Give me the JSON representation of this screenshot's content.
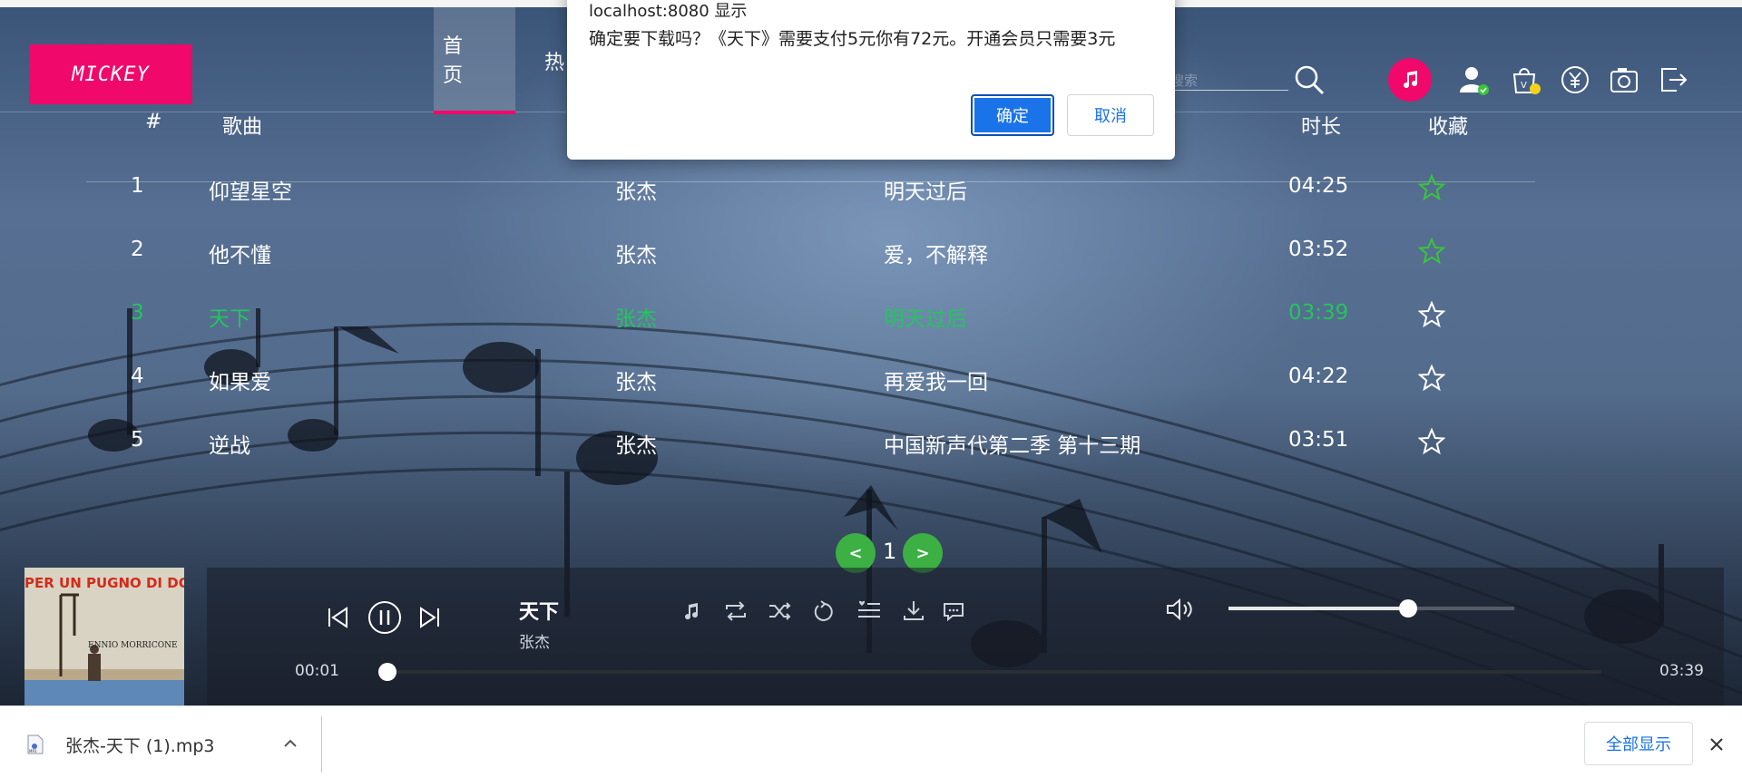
{
  "header": {
    "logo": "MICKEY",
    "nav": {
      "home": "首 页",
      "hot": "热"
    },
    "search_placeholder": "搜索"
  },
  "table": {
    "columns": {
      "index": "#",
      "song": "歌曲",
      "duration": "时长",
      "favorite": "收藏"
    },
    "rows": [
      {
        "index": "1",
        "song": "仰望星空",
        "singer": "张杰",
        "album": "明天过后",
        "duration": "04:25",
        "favorited": true,
        "playing": false
      },
      {
        "index": "2",
        "song": "他不懂",
        "singer": "张杰",
        "album": "爱，不解释",
        "duration": "03:52",
        "favorited": true,
        "playing": false
      },
      {
        "index": "3",
        "song": "天下",
        "singer": "张杰",
        "album": "明天过后",
        "duration": "03:39",
        "favorited": false,
        "playing": true
      },
      {
        "index": "4",
        "song": "如果爱",
        "singer": "张杰",
        "album": "再爱我一回",
        "duration": "04:22",
        "favorited": false,
        "playing": false
      },
      {
        "index": "5",
        "song": "逆战",
        "singer": "张杰",
        "album": "中国新声代第二季 第十三期",
        "duration": "03:51",
        "favorited": false,
        "playing": false
      }
    ]
  },
  "pagination": {
    "prev": "<",
    "page": "1",
    "next": ">"
  },
  "player": {
    "cover_text_top": "PER UN PUGNO DI DOLLA",
    "cover_text_composer": "ENNIO MORRICONE",
    "title": "天下",
    "artist": "张杰",
    "current_time": "00:01",
    "total_time": "03:39",
    "progress": 0.005,
    "volume": 0.63
  },
  "dialog": {
    "title": "localhost:8080 显示",
    "message": "确定要下载吗？《天下》需要支付5元你有72元。开通会员只需要3元",
    "ok": "确定",
    "cancel": "取消"
  },
  "download_bar": {
    "file_name": "张杰-天下 (1).mp3",
    "file_type": "MP3",
    "show_all": "全部显示"
  },
  "colors": {
    "brand": "#f0086a",
    "playing": "#23c55e",
    "favorite_star": "#3ac53a",
    "pager": "#3cb043",
    "dialog_primary": "#1a73e8"
  }
}
